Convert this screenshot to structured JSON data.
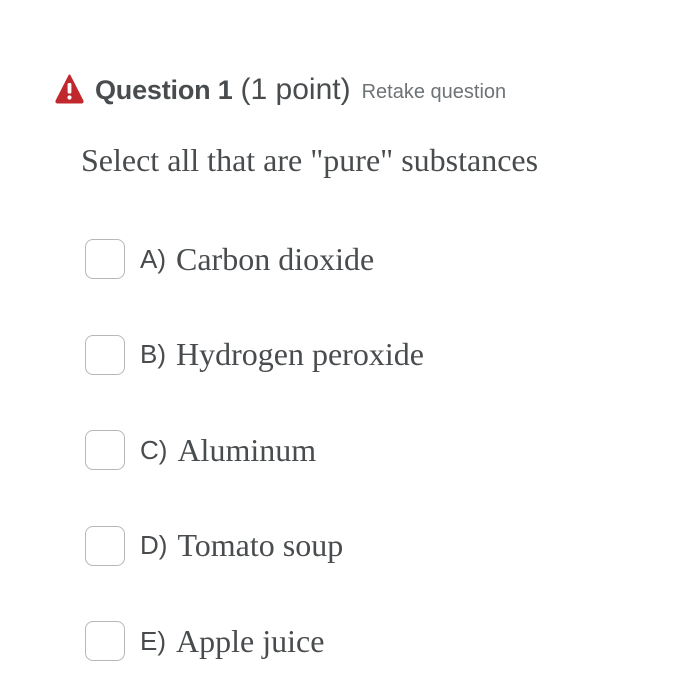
{
  "question": {
    "number_label": "Question 1",
    "points_label": "(1 point)",
    "retake_label": "Retake question",
    "prompt": "Select all that are \"pure\" substances",
    "status_icon": "warning-icon",
    "status_color": "#c0282d"
  },
  "options": [
    {
      "letter": "A)",
      "text": "Carbon dioxide",
      "checked": false
    },
    {
      "letter": "B)",
      "text": "Hydrogen peroxide",
      "checked": false
    },
    {
      "letter": "C)",
      "text": "Aluminum",
      "checked": false
    },
    {
      "letter": "D)",
      "text": "Tomato soup",
      "checked": false
    },
    {
      "letter": "E)",
      "text": "Apple juice",
      "checked": false
    }
  ]
}
